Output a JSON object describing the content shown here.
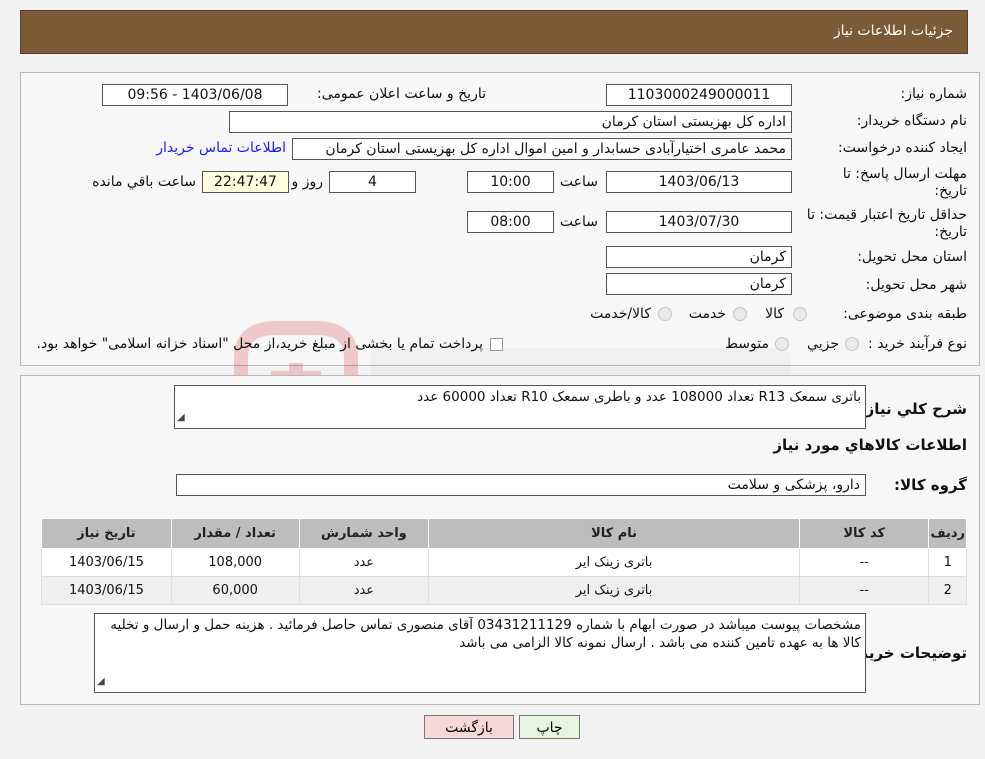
{
  "header": {
    "title": "جزئیات اطلاعات نیاز"
  },
  "fields": {
    "need_number_label": "شماره نیاز:",
    "need_number": "1103000249000011",
    "announce_label": "تاریخ و ساعت اعلان عمومی:",
    "announce_value": "1403/06/08 - 09:56",
    "buyer_org_label": "نام دستگاه خریدار:",
    "buyer_org": "اداره کل بهزیستی استان کرمان",
    "requester_label": "ایجاد کننده درخواست:",
    "requester": "محمد عامری اختیارآبادی حسابدار و امین اموال اداره کل بهزیستی استان کرمان",
    "buyer_contact_link": "اطلاعات تماس خریدار",
    "deadline_label_1": "مهلت ارسال پاسخ: تا",
    "deadline_label_2": "تاریخ:",
    "deadline_date": "1403/06/13",
    "time_label": "ساعت",
    "deadline_time": "10:00",
    "days_value": "4",
    "days_label": "روز و",
    "remaining_time": "22:47:47",
    "remaining_label": "ساعت باقي مانده",
    "validity_label_1": "حداقل تاریخ اعتبار قیمت: تا",
    "validity_label_2": "تاریخ:",
    "validity_date": "1403/07/30",
    "validity_time": "08:00",
    "province_label": "استان محل تحویل:",
    "province": "کرمان",
    "city_label": "شهر محل تحویل:",
    "city": "کرمان",
    "category_label": "طبقه بندی موضوعی:",
    "category_options": [
      "کالا",
      "خدمت",
      "کالا/خدمت"
    ],
    "process_label": "نوع فرآیند خرید :",
    "process_options": [
      "جزيي",
      "متوسط"
    ],
    "payment_note": "پرداخت تمام یا بخشی از مبلغ خرید،از محل \"اسناد خزانه اسلامی\" خواهد بود."
  },
  "description": {
    "label": "شرح کلي نياز:",
    "text": "باتری سمعک R13 تعداد 108000 عدد و باطری سمعک R10 تعداد 60000 عدد"
  },
  "goods": {
    "section_title": "اطلاعات کالاهاي مورد نياز",
    "group_label": "گروه کالا:",
    "group_value": "دارو، پزشکی و سلامت",
    "columns": [
      "ردیف",
      "کد کالا",
      "نام کالا",
      "واحد شمارش",
      "تعداد / مقدار",
      "تاریخ نیاز"
    ],
    "rows": [
      [
        "1",
        "--",
        "باتری زینک ایر",
        "عدد",
        "108,000",
        "1403/06/15"
      ],
      [
        "2",
        "--",
        "باتری زینک ایر",
        "عدد",
        "60,000",
        "1403/06/15"
      ]
    ]
  },
  "buyer_notes": {
    "label": "توضیحات خریدار:",
    "text": "مشخصات پیوست میباشد در صورت ابهام با شماره 03431211129 آقای منصوری تماس حاصل فرمائید . هزینه حمل و ارسال و تخلیه کالا ها به عهده تامین کننده می باشد . ارسال نمونه کالا الزامی می باشد"
  },
  "buttons": {
    "print": "چاپ",
    "back": "بازگشت"
  },
  "colors": {
    "header_bg": "#7a5a37",
    "back_button_bg": "#f8d7d7",
    "print_button_bg": "#e6f5dd",
    "link": "#1a1aff"
  }
}
